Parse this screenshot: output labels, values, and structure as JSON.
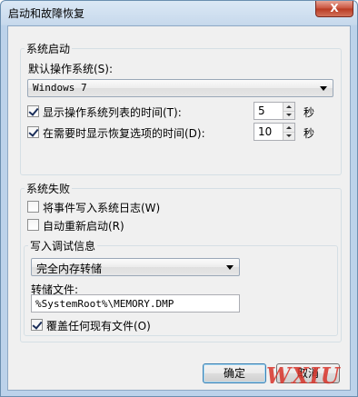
{
  "window": {
    "title": "启动和故障恢复",
    "close_glyph": "X"
  },
  "startup": {
    "group_title": "系统启动",
    "default_os_label": "默认操作系统(S):",
    "default_os_value": "Windows 7",
    "show_list": {
      "label": "显示操作系统列表的时间(T):",
      "checked": true,
      "value": "5",
      "unit": "秒"
    },
    "show_recovery": {
      "label": "在需要时显示恢复选项的时间(D):",
      "checked": true,
      "value": "10",
      "unit": "秒"
    }
  },
  "failure": {
    "group_title": "系统失败",
    "write_event": {
      "label": "将事件写入系统日志(W)",
      "checked": false
    },
    "auto_restart": {
      "label": "自动重新启动(R)",
      "checked": false
    },
    "debug": {
      "group_title": "写入调试信息",
      "dump_type": "完全内存转储",
      "dump_file_label": "转储文件:",
      "dump_file_value": "%SystemRoot%\\MEMORY.DMP",
      "overwrite": {
        "label": "覆盖任何现有文件(O)",
        "checked": true
      }
    }
  },
  "buttons": {
    "ok": "确定",
    "cancel": "取消"
  },
  "watermark": "WXIU"
}
